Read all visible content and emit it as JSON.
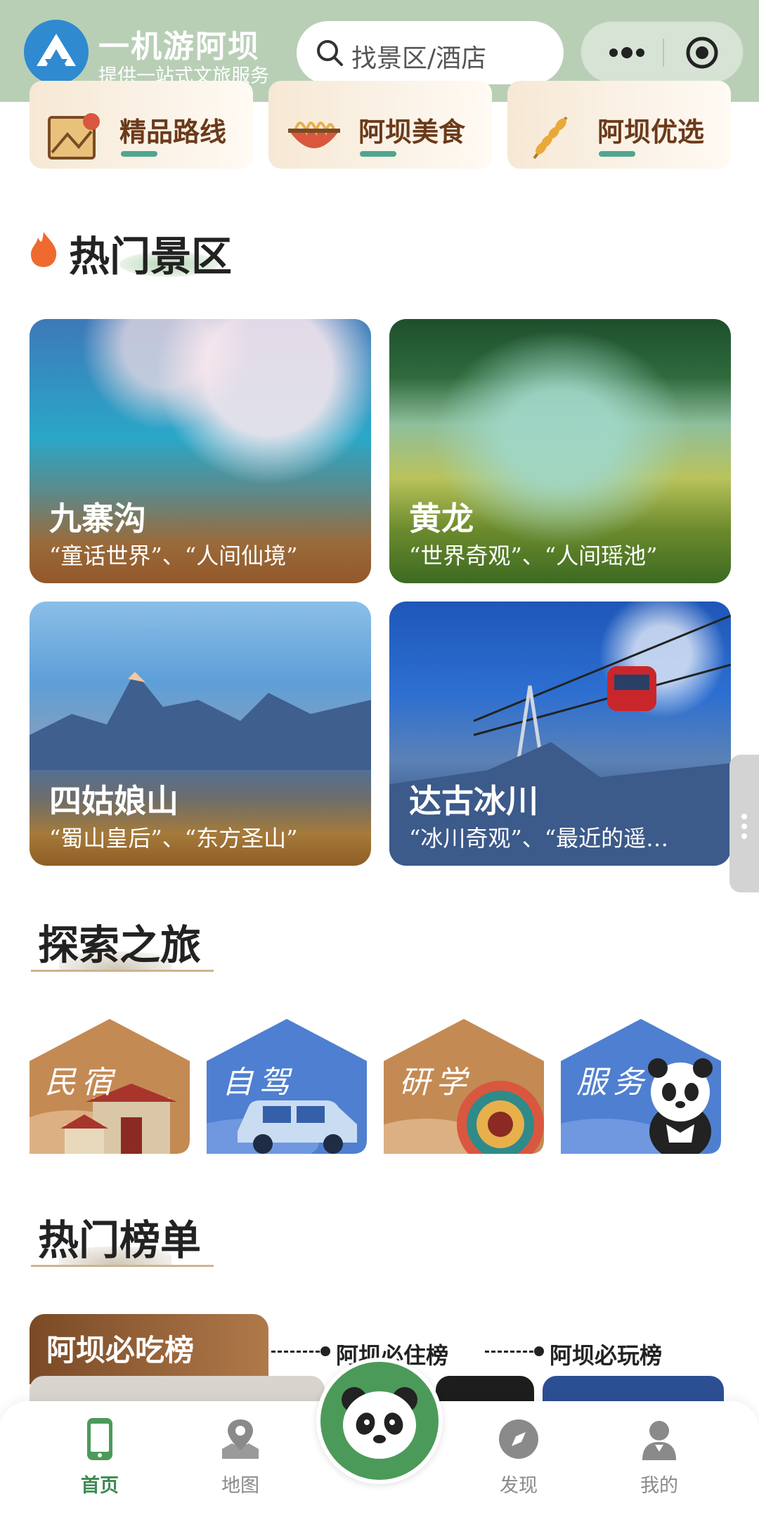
{
  "header": {
    "title": "一机游阿坝",
    "subtitle": "提供一站式文旅服务",
    "search_placeholder": "找景区/酒店",
    "logo_icon": "aba-logo-icon",
    "bg_color": "#b8cfb6"
  },
  "categories": [
    {
      "label": "精品路线",
      "icon": "map-route-icon"
    },
    {
      "label": "阿坝美食",
      "icon": "noodle-bowl-icon"
    },
    {
      "label": "阿坝优选",
      "icon": "wheat-icon"
    }
  ],
  "hot_scenic": {
    "title": "热门景区",
    "items": [
      {
        "name": "九寨沟",
        "desc": "“童话世界”、“人间仙境”"
      },
      {
        "name": "黄龙",
        "desc": "“世界奇观”、“人间瑶池”"
      },
      {
        "name": "四姑娘山",
        "desc": "“蜀山皇后”、“东方圣山”"
      },
      {
        "name": "达古冰川",
        "desc": "“冰川奇观”、“最近的遥…"
      }
    ]
  },
  "explore": {
    "title": "探索之旅",
    "tiles": [
      {
        "label": "民宿",
        "color": "#c48a54"
      },
      {
        "label": "自驾",
        "color": "#4f7fd0"
      },
      {
        "label": "研学",
        "color": "#c48a54"
      },
      {
        "label": "服务",
        "color": "#4f7fd0"
      }
    ]
  },
  "rankings": {
    "title": "热门榜单",
    "tabs": [
      "阿坝必吃榜",
      "阿坝必住榜",
      "阿坝必玩榜"
    ],
    "active_tab": "阿坝必吃榜"
  },
  "tabbar": {
    "items": [
      {
        "label": "首页",
        "icon": "phone-icon",
        "active": true
      },
      {
        "label": "地图",
        "icon": "map-pin-icon",
        "active": false
      },
      {
        "label": "发现",
        "icon": "compass-icon",
        "active": false
      },
      {
        "label": "我的",
        "icon": "user-icon",
        "active": false
      }
    ],
    "center_icon": "panda-icon",
    "active_color": "#3f8a53"
  }
}
